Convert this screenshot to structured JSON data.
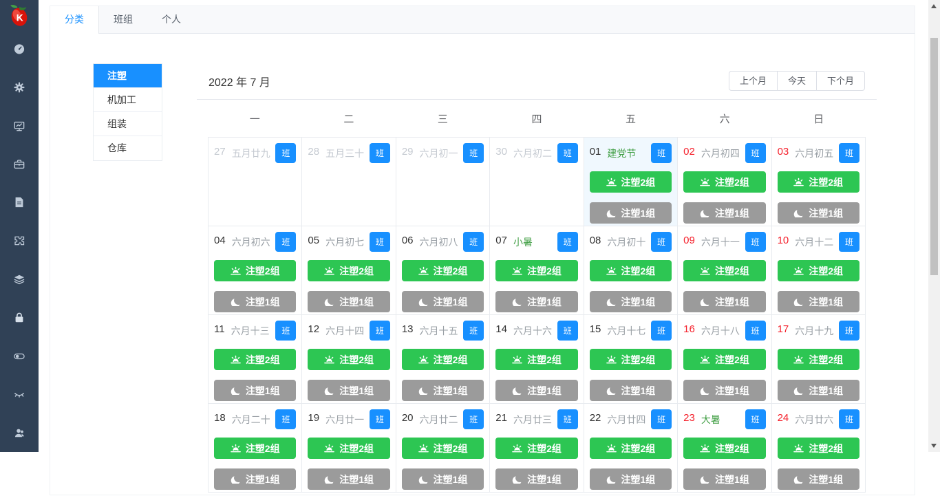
{
  "sidebar": {
    "logo_letter": "K",
    "icons": [
      {
        "name": "dashboard-icon"
      },
      {
        "name": "gear-icon"
      },
      {
        "name": "monitor-chart-icon"
      },
      {
        "name": "toolbox-icon"
      },
      {
        "name": "document-icon"
      },
      {
        "name": "puzzle-icon"
      },
      {
        "name": "layers-icon"
      },
      {
        "name": "lock-icon"
      },
      {
        "name": "toggle-icon"
      },
      {
        "name": "eye-closed-icon"
      },
      {
        "name": "users-icon"
      }
    ]
  },
  "tabs": [
    {
      "label": "分类",
      "active": true
    },
    {
      "label": "班组",
      "active": false
    },
    {
      "label": "个人",
      "active": false
    }
  ],
  "categories": [
    {
      "label": "注塑",
      "active": true
    },
    {
      "label": "机加工",
      "active": false
    },
    {
      "label": "组装",
      "active": false
    },
    {
      "label": "仓库",
      "active": false
    }
  ],
  "calendar": {
    "title": "2022 年 7 月",
    "nav_buttons": {
      "prev": "上个月",
      "today": "今天",
      "next": "下个月"
    },
    "weekdays": [
      "一",
      "二",
      "三",
      "四",
      "五",
      "六",
      "日"
    ],
    "badge_label": "班",
    "day_shift_label": "注塑2组",
    "night_shift_label": "注塑1组",
    "day_shift_icon": "sunrise-icon",
    "night_shift_icon": "moon-icon",
    "days": [
      {
        "num": "27",
        "label": "五月廿九",
        "other_month": true,
        "weekend": false,
        "festival": false,
        "today": false,
        "shifts": false
      },
      {
        "num": "28",
        "label": "五月三十",
        "other_month": true,
        "weekend": false,
        "festival": false,
        "today": false,
        "shifts": false
      },
      {
        "num": "29",
        "label": "六月初一",
        "other_month": true,
        "weekend": false,
        "festival": false,
        "today": false,
        "shifts": false
      },
      {
        "num": "30",
        "label": "六月初二",
        "other_month": true,
        "weekend": false,
        "festival": false,
        "today": false,
        "shifts": false
      },
      {
        "num": "01",
        "label": "建党节",
        "other_month": false,
        "weekend": false,
        "festival": true,
        "today": true,
        "shifts": true
      },
      {
        "num": "02",
        "label": "六月初四",
        "other_month": false,
        "weekend": true,
        "festival": false,
        "today": false,
        "shifts": true
      },
      {
        "num": "03",
        "label": "六月初五",
        "other_month": false,
        "weekend": true,
        "festival": false,
        "today": false,
        "shifts": true
      },
      {
        "num": "04",
        "label": "六月初六",
        "other_month": false,
        "weekend": false,
        "festival": false,
        "today": false,
        "shifts": true
      },
      {
        "num": "05",
        "label": "六月初七",
        "other_month": false,
        "weekend": false,
        "festival": false,
        "today": false,
        "shifts": true
      },
      {
        "num": "06",
        "label": "六月初八",
        "other_month": false,
        "weekend": false,
        "festival": false,
        "today": false,
        "shifts": true
      },
      {
        "num": "07",
        "label": "小暑",
        "other_month": false,
        "weekend": false,
        "festival": true,
        "today": false,
        "shifts": true
      },
      {
        "num": "08",
        "label": "六月初十",
        "other_month": false,
        "weekend": false,
        "festival": false,
        "today": false,
        "shifts": true
      },
      {
        "num": "09",
        "label": "六月十一",
        "other_month": false,
        "weekend": true,
        "festival": false,
        "today": false,
        "shifts": true
      },
      {
        "num": "10",
        "label": "六月十二",
        "other_month": false,
        "weekend": true,
        "festival": false,
        "today": false,
        "shifts": true
      },
      {
        "num": "11",
        "label": "六月十三",
        "other_month": false,
        "weekend": false,
        "festival": false,
        "today": false,
        "shifts": true
      },
      {
        "num": "12",
        "label": "六月十四",
        "other_month": false,
        "weekend": false,
        "festival": false,
        "today": false,
        "shifts": true
      },
      {
        "num": "13",
        "label": "六月十五",
        "other_month": false,
        "weekend": false,
        "festival": false,
        "today": false,
        "shifts": true
      },
      {
        "num": "14",
        "label": "六月十六",
        "other_month": false,
        "weekend": false,
        "festival": false,
        "today": false,
        "shifts": true
      },
      {
        "num": "15",
        "label": "六月十七",
        "other_month": false,
        "weekend": false,
        "festival": false,
        "today": false,
        "shifts": true
      },
      {
        "num": "16",
        "label": "六月十八",
        "other_month": false,
        "weekend": true,
        "festival": false,
        "today": false,
        "shifts": true
      },
      {
        "num": "17",
        "label": "六月十九",
        "other_month": false,
        "weekend": true,
        "festival": false,
        "today": false,
        "shifts": true
      },
      {
        "num": "18",
        "label": "六月二十",
        "other_month": false,
        "weekend": false,
        "festival": false,
        "today": false,
        "shifts": true
      },
      {
        "num": "19",
        "label": "六月廿一",
        "other_month": false,
        "weekend": false,
        "festival": false,
        "today": false,
        "shifts": true
      },
      {
        "num": "20",
        "label": "六月廿二",
        "other_month": false,
        "weekend": false,
        "festival": false,
        "today": false,
        "shifts": true
      },
      {
        "num": "21",
        "label": "六月廿三",
        "other_month": false,
        "weekend": false,
        "festival": false,
        "today": false,
        "shifts": true
      },
      {
        "num": "22",
        "label": "六月廿四",
        "other_month": false,
        "weekend": false,
        "festival": false,
        "today": false,
        "shifts": true
      },
      {
        "num": "23",
        "label": "大暑",
        "other_month": false,
        "weekend": true,
        "festival": true,
        "today": false,
        "shifts": true
      },
      {
        "num": "24",
        "label": "六月廿六",
        "other_month": false,
        "weekend": true,
        "festival": false,
        "today": false,
        "shifts": true
      }
    ]
  },
  "colors": {
    "primary_blue": "#1890ff",
    "day_shift_green": "#2dc653",
    "night_shift_gray": "#9b9b9b",
    "weekend_red": "#f5222d",
    "festival_green": "#43a047",
    "sidebar_bg": "#304156",
    "today_bg": "#f0f8fe"
  }
}
